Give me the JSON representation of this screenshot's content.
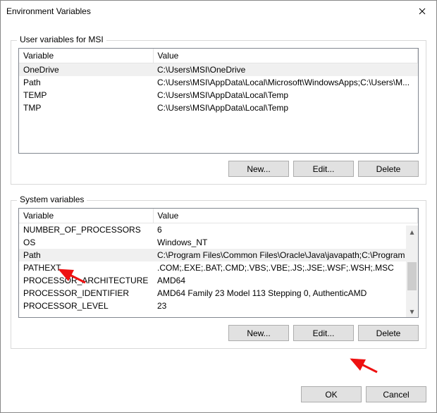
{
  "window": {
    "title": "Environment Variables"
  },
  "user": {
    "legend": "User variables for MSI",
    "headers": {
      "variable": "Variable",
      "value": "Value"
    },
    "rows": [
      {
        "var": "OneDrive",
        "val": "C:\\Users\\MSI\\OneDrive",
        "hl": true
      },
      {
        "var": "Path",
        "val": "C:\\Users\\MSI\\AppData\\Local\\Microsoft\\WindowsApps;C:\\Users\\M..."
      },
      {
        "var": "TEMP",
        "val": "C:\\Users\\MSI\\AppData\\Local\\Temp"
      },
      {
        "var": "TMP",
        "val": "C:\\Users\\MSI\\AppData\\Local\\Temp"
      }
    ],
    "buttons": {
      "new": "New...",
      "edit": "Edit...",
      "delete": "Delete"
    }
  },
  "system": {
    "legend": "System variables",
    "headers": {
      "variable": "Variable",
      "value": "Value"
    },
    "rows": [
      {
        "var": "NUMBER_OF_PROCESSORS",
        "val": "6"
      },
      {
        "var": "OS",
        "val": "Windows_NT"
      },
      {
        "var": "Path",
        "val": "C:\\Program Files\\Common Files\\Oracle\\Java\\javapath;C:\\Program ...",
        "hl": true
      },
      {
        "var": "PATHEXT",
        "val": ".COM;.EXE;.BAT;.CMD;.VBS;.VBE;.JS;.JSE;.WSF;.WSH;.MSC"
      },
      {
        "var": "PROCESSOR_ARCHITECTURE",
        "val": "AMD64"
      },
      {
        "var": "PROCESSOR_IDENTIFIER",
        "val": "AMD64 Family 23 Model 113 Stepping 0, AuthenticAMD"
      },
      {
        "var": "PROCESSOR_LEVEL",
        "val": "23"
      }
    ],
    "buttons": {
      "new": "New...",
      "edit": "Edit...",
      "delete": "Delete"
    }
  },
  "footer": {
    "ok": "OK",
    "cancel": "Cancel"
  }
}
